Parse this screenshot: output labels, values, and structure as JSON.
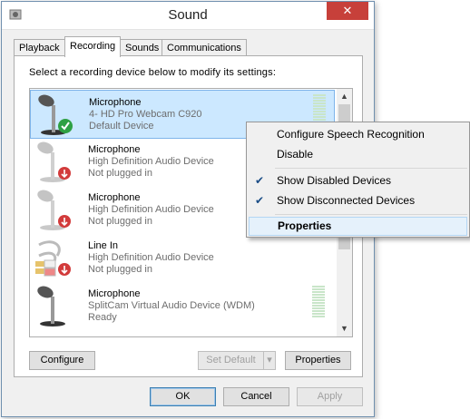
{
  "window": {
    "title": "Sound",
    "close_glyph": "✕"
  },
  "tabs": [
    {
      "label": "Playback",
      "active": false
    },
    {
      "label": "Recording",
      "active": true
    },
    {
      "label": "Sounds",
      "active": false
    },
    {
      "label": "Communications",
      "active": false
    }
  ],
  "instruction": "Select a recording device below to modify its settings:",
  "devices": [
    {
      "name": "Microphone",
      "detail": "4- HD Pro Webcam C920",
      "status": "Default Device",
      "icon": "microphone-icon",
      "badge": "default-check-badge",
      "selected": true,
      "level": 0.15
    },
    {
      "name": "Microphone",
      "detail": "High Definition Audio Device",
      "status": "Not plugged in",
      "icon": "microphone-icon",
      "badge": "unplugged-badge",
      "selected": false
    },
    {
      "name": "Microphone",
      "detail": "High Definition Audio Device",
      "status": "Not plugged in",
      "icon": "microphone-icon",
      "badge": "unplugged-badge",
      "selected": false
    },
    {
      "name": "Line In",
      "detail": "High Definition Audio Device",
      "status": "Not plugged in",
      "icon": "line-in-cable-icon",
      "badge": "unplugged-badge",
      "selected": false
    },
    {
      "name": "Microphone",
      "detail": "SplitCam Virtual Audio Device (WDM)",
      "status": "Ready",
      "icon": "microphone-icon",
      "badge": "",
      "selected": false,
      "level": 0
    }
  ],
  "buttons": {
    "configure": "Configure",
    "set_default": "Set Default",
    "properties": "Properties",
    "ok": "OK",
    "cancel": "Cancel",
    "apply": "Apply"
  },
  "context_menu": {
    "items": [
      {
        "label": "Configure Speech Recognition",
        "checked": false
      },
      {
        "label": "Disable",
        "checked": false
      },
      {
        "label": "Show Disabled Devices",
        "checked": true
      },
      {
        "label": "Show Disconnected Devices",
        "checked": true
      },
      {
        "label": "Properties",
        "checked": false,
        "highlighted": true
      }
    ]
  },
  "colors": {
    "selection": "#cce8ff",
    "close_button": "#c7403a",
    "meter_on": "#3ca83c",
    "menu_highlight": "#e5f1fb"
  }
}
